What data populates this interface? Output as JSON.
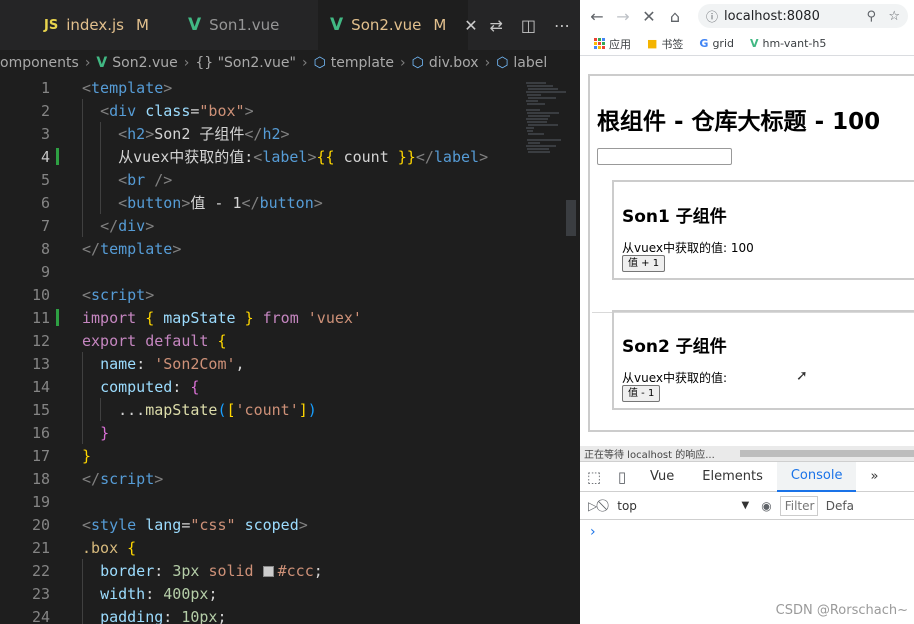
{
  "editor": {
    "tabs": [
      {
        "label": "index.js",
        "badge": "M",
        "icon": "JS",
        "icon_name": "javascript-icon"
      },
      {
        "label": "Son1.vue",
        "badge": "",
        "icon": "V",
        "icon_name": "vue-icon"
      },
      {
        "label": "Son2.vue",
        "badge": "M",
        "icon": "V",
        "icon_name": "vue-icon",
        "close": "✕"
      }
    ],
    "breadcrumb": [
      "omponents",
      "Son2.vue",
      "{} \"Son2.vue\"",
      "template",
      "div.box",
      "label"
    ],
    "lines": [
      {
        "n": "1",
        "segs": [
          [
            "c-br",
            "<"
          ],
          [
            "c-tag",
            "template"
          ],
          [
            "c-br",
            ">"
          ]
        ]
      },
      {
        "n": "2",
        "segs": [
          [
            "c-txt",
            "  "
          ],
          [
            "c-br",
            "<"
          ],
          [
            "c-tag",
            "div"
          ],
          [
            "c-txt",
            " "
          ],
          [
            "c-attr",
            "class"
          ],
          [
            "c-txt",
            "="
          ],
          [
            "c-str",
            "\"box\""
          ],
          [
            "c-br",
            ">"
          ]
        ]
      },
      {
        "n": "3",
        "segs": [
          [
            "c-txt",
            "    "
          ],
          [
            "c-br",
            "<"
          ],
          [
            "c-tag",
            "h2"
          ],
          [
            "c-br",
            ">"
          ],
          [
            "c-txt",
            "Son2 子组件"
          ],
          [
            "c-br",
            "</"
          ],
          [
            "c-tag",
            "h2"
          ],
          [
            "c-br",
            ">"
          ]
        ]
      },
      {
        "n": "4",
        "segs": [
          [
            "c-txt",
            "    从vuex中获取的值:"
          ],
          [
            "c-br",
            "<"
          ],
          [
            "c-tag",
            "label"
          ],
          [
            "c-br",
            ">"
          ],
          [
            "c-brace",
            "{{"
          ],
          [
            "c-txt",
            " count "
          ],
          [
            "c-brace",
            "}}"
          ],
          [
            "c-br",
            "</"
          ],
          [
            "c-tag",
            "label"
          ],
          [
            "c-br",
            ">"
          ]
        ]
      },
      {
        "n": "5",
        "segs": [
          [
            "c-txt",
            "    "
          ],
          [
            "c-br",
            "<"
          ],
          [
            "c-tag",
            "br"
          ],
          [
            "c-txt",
            " "
          ],
          [
            "c-br",
            "/>"
          ]
        ]
      },
      {
        "n": "6",
        "segs": [
          [
            "c-txt",
            "    "
          ],
          [
            "c-br",
            "<"
          ],
          [
            "c-tag",
            "button"
          ],
          [
            "c-br",
            ">"
          ],
          [
            "c-txt",
            "值 - 1"
          ],
          [
            "c-br",
            "</"
          ],
          [
            "c-tag",
            "button"
          ],
          [
            "c-br",
            ">"
          ]
        ]
      },
      {
        "n": "7",
        "segs": [
          [
            "c-txt",
            "  "
          ],
          [
            "c-br",
            "</"
          ],
          [
            "c-tag",
            "div"
          ],
          [
            "c-br",
            ">"
          ]
        ]
      },
      {
        "n": "8",
        "segs": [
          [
            "c-br",
            "</"
          ],
          [
            "c-tag",
            "template"
          ],
          [
            "c-br",
            ">"
          ]
        ]
      },
      {
        "n": "9",
        "segs": []
      },
      {
        "n": "10",
        "segs": [
          [
            "c-br",
            "<"
          ],
          [
            "c-tag",
            "script"
          ],
          [
            "c-br",
            ">"
          ]
        ]
      },
      {
        "n": "11",
        "segs": [
          [
            "c-kw",
            "import"
          ],
          [
            "c-txt",
            " "
          ],
          [
            "c-brace",
            "{"
          ],
          [
            "c-txt",
            " "
          ],
          [
            "c-var",
            "mapState"
          ],
          [
            "c-txt",
            " "
          ],
          [
            "c-brace",
            "}"
          ],
          [
            "c-txt",
            " "
          ],
          [
            "c-kw",
            "from"
          ],
          [
            "c-txt",
            " "
          ],
          [
            "c-str",
            "'vuex'"
          ]
        ]
      },
      {
        "n": "12",
        "segs": [
          [
            "c-kw",
            "export"
          ],
          [
            "c-txt",
            " "
          ],
          [
            "c-kw",
            "default"
          ],
          [
            "c-txt",
            " "
          ],
          [
            "c-brace",
            "{"
          ]
        ]
      },
      {
        "n": "13",
        "segs": [
          [
            "c-txt",
            "  "
          ],
          [
            "c-prop",
            "name"
          ],
          [
            "c-txt",
            ": "
          ],
          [
            "c-str",
            "'Son2Com'"
          ],
          [
            "c-txt",
            ","
          ]
        ]
      },
      {
        "n": "14",
        "segs": [
          [
            "c-txt",
            "  "
          ],
          [
            "c-prop",
            "computed"
          ],
          [
            "c-txt",
            ": "
          ],
          [
            "c-brace2",
            "{"
          ]
        ]
      },
      {
        "n": "15",
        "segs": [
          [
            "c-txt",
            "    ..."
          ],
          [
            "c-fn",
            "mapState"
          ],
          [
            "c-brace3",
            "("
          ],
          [
            "c-brace",
            "["
          ],
          [
            "c-str",
            "'count'"
          ],
          [
            "c-brace",
            "]"
          ],
          [
            "c-brace3",
            ")"
          ]
        ]
      },
      {
        "n": "16",
        "segs": [
          [
            "c-txt",
            "  "
          ],
          [
            "c-brace2",
            "}"
          ]
        ]
      },
      {
        "n": "17",
        "segs": [
          [
            "c-brace",
            "}"
          ]
        ]
      },
      {
        "n": "18",
        "segs": [
          [
            "c-br",
            "</"
          ],
          [
            "c-tag",
            "script"
          ],
          [
            "c-br",
            ">"
          ]
        ]
      },
      {
        "n": "19",
        "segs": []
      },
      {
        "n": "20",
        "segs": [
          [
            "c-br",
            "<"
          ],
          [
            "c-tag",
            "style"
          ],
          [
            "c-txt",
            " "
          ],
          [
            "c-attr",
            "lang"
          ],
          [
            "c-txt",
            "="
          ],
          [
            "c-str",
            "\"css\""
          ],
          [
            "c-txt",
            " "
          ],
          [
            "c-attr",
            "scoped"
          ],
          [
            "c-br",
            ">"
          ]
        ]
      },
      {
        "n": "21",
        "segs": [
          [
            "c-sel",
            ".box"
          ],
          [
            "c-txt",
            " "
          ],
          [
            "c-brace",
            "{"
          ]
        ]
      },
      {
        "n": "22",
        "segs": [
          [
            "c-txt",
            "  "
          ],
          [
            "c-prop",
            "border"
          ],
          [
            "c-txt",
            ": "
          ],
          [
            "c-num",
            "3px"
          ],
          [
            "c-txt",
            " "
          ],
          [
            "c-str",
            "solid"
          ],
          [
            "c-txt",
            " "
          ],
          [
            "swatch",
            ""
          ],
          [
            "c-str",
            "#ccc"
          ],
          [
            "c-txt",
            ";"
          ]
        ]
      },
      {
        "n": "23",
        "segs": [
          [
            "c-txt",
            "  "
          ],
          [
            "c-prop",
            "width"
          ],
          [
            "c-txt",
            ": "
          ],
          [
            "c-num",
            "400px"
          ],
          [
            "c-txt",
            ";"
          ]
        ]
      },
      {
        "n": "24",
        "segs": [
          [
            "c-txt",
            "  "
          ],
          [
            "c-prop",
            "padding"
          ],
          [
            "c-txt",
            ": "
          ],
          [
            "c-num",
            "10px"
          ],
          [
            "c-txt",
            ";"
          ]
        ]
      }
    ],
    "current_line": "4"
  },
  "browser": {
    "url": "localhost:8080",
    "bookmarks": [
      "应用",
      "书签",
      "grid",
      "hm-vant-h5"
    ],
    "app_title": "根组件 - 仓库大标题 - 100",
    "son1": {
      "title": "Son1 子组件",
      "value_text": "从vuex中获取的值: 100",
      "button": "值 + 1"
    },
    "son2": {
      "title": "Son2 子组件",
      "value_text": "从vuex中获取的值:",
      "button": "值 - 1"
    },
    "status": "正在等待 localhost 的响应...",
    "devtools": {
      "tabs": [
        "Vue",
        "Elements",
        "Console"
      ],
      "more": "»",
      "context": "top",
      "filter": "Filter",
      "default_levels": "Defa",
      "prompt": "›"
    }
  },
  "watermark": "CSDN @Rorschach~"
}
